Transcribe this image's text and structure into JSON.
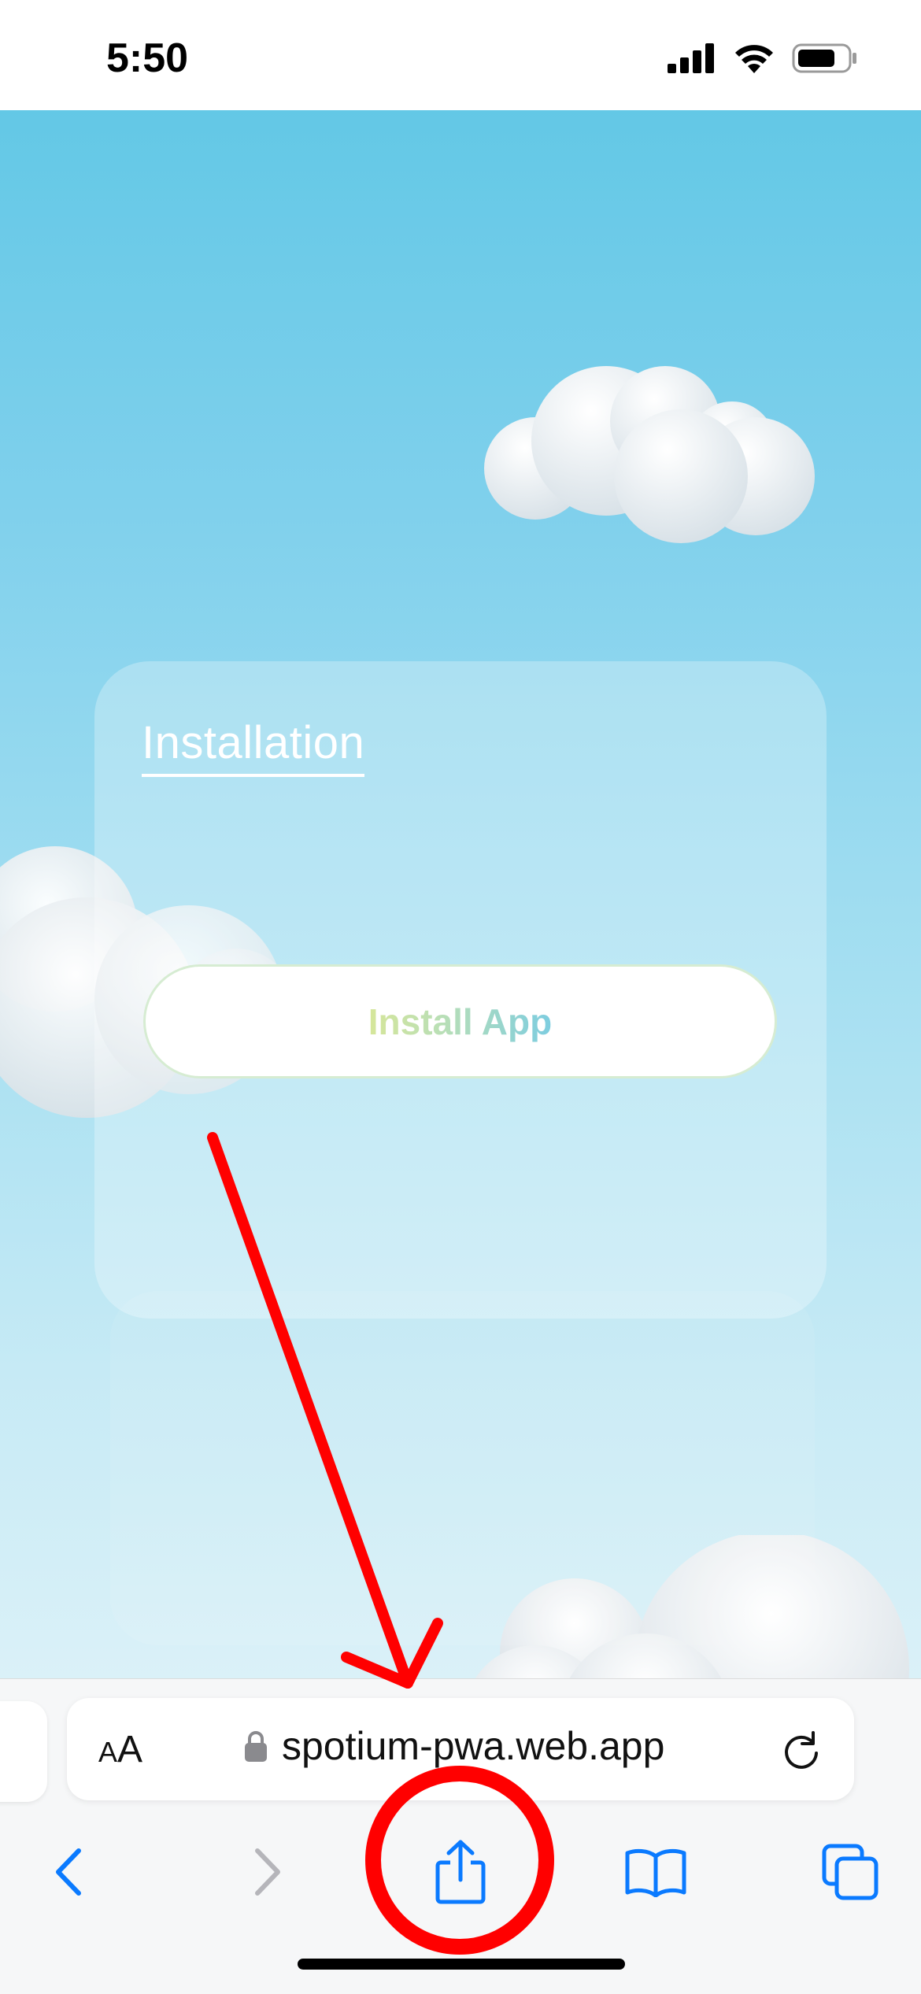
{
  "status_bar": {
    "time": "5:50",
    "icons": [
      "cellular-signal-icon",
      "wifi-icon",
      "battery-icon"
    ]
  },
  "page": {
    "card_title": "Installation",
    "install_button_label": "Install App"
  },
  "browser": {
    "text_size_button": {
      "small": "A",
      "big": "A"
    },
    "url": "spotium-pwa.web.app",
    "icons": [
      "lock-icon",
      "reload-icon",
      "back-icon",
      "forward-icon",
      "share-icon",
      "bookmarks-icon",
      "tabs-icon"
    ]
  },
  "annotations": {
    "arrow_color": "#ff0000",
    "circle_color": "#ff0000",
    "target": "share-button"
  },
  "colors": {
    "sky_top": "#63c8e6",
    "sky_bottom": "#dbf1f8",
    "accent_blue": "#0a7aff",
    "disabled_gray": "#b5b5ba"
  }
}
